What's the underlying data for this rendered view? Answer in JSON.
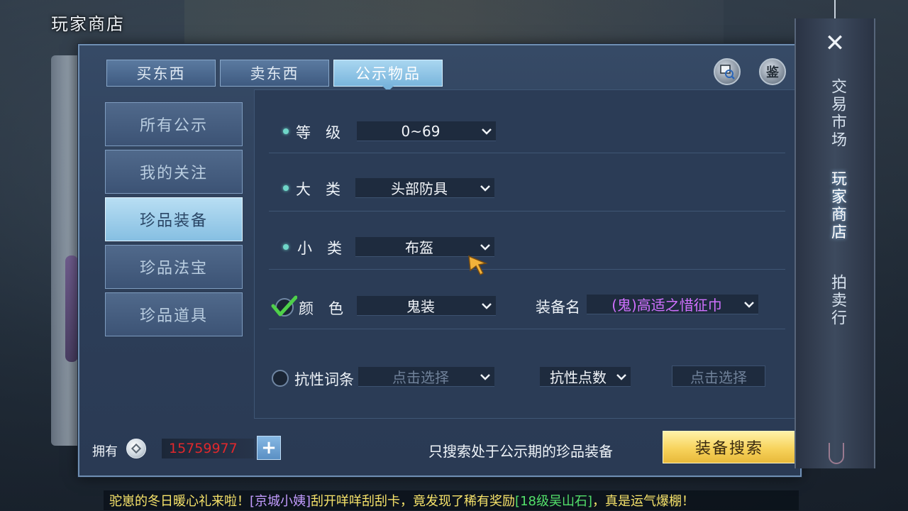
{
  "store_title": "玩家商店",
  "tabs": [
    {
      "label": "买东西",
      "active": false
    },
    {
      "label": "卖东西",
      "active": false
    },
    {
      "label": "公示物品",
      "active": true
    }
  ],
  "top_icons": {
    "search": "search-icon",
    "appraise_label": "鉴"
  },
  "side_menu": [
    {
      "label": "所有公示",
      "active": false
    },
    {
      "label": "我的关注",
      "active": false
    },
    {
      "label": "珍品装备",
      "active": true
    },
    {
      "label": "珍品法宝",
      "active": false
    },
    {
      "label": "珍品道具",
      "active": false
    }
  ],
  "filters": {
    "level": {
      "label": "等　级",
      "value": "0~69"
    },
    "major": {
      "label": "大　类",
      "value": "头部防具"
    },
    "minor": {
      "label": "小　类",
      "value": "布盔"
    },
    "color": {
      "label": "颜　色",
      "value": "鬼装",
      "checked": true
    },
    "equip_name": {
      "label": "装备名",
      "value": "(鬼)高适之惜征巾",
      "value_color": "#d070ff"
    },
    "resist_word": {
      "label": "抗性词条",
      "placeholder": "点击选择",
      "checked": false
    },
    "resist_points": {
      "label": "抗性点数",
      "placeholder": "点击选择"
    }
  },
  "bottom": {
    "own_label": "拥有",
    "money": "15759977",
    "hint": "只搜索处于公示期的珍品装备",
    "search_button": "装备搜索"
  },
  "right_tabs": [
    {
      "label": "交易市场",
      "active": false
    },
    {
      "label": "玩家商店",
      "active": true
    },
    {
      "label": "拍卖行",
      "active": false
    }
  ],
  "ticker": {
    "part1": "驼崽的冬日暖心礼来啦！",
    "part2": "[京城小姨]",
    "part3": "刮开咩咩刮刮卡，竟发现了稀有奖励",
    "part4": "[18级吴山石]",
    "part5": "，真是运气爆棚！"
  },
  "colors": {
    "accent": "#79b5dc",
    "search_button": "#f7d35c",
    "money": "#e0282c"
  }
}
